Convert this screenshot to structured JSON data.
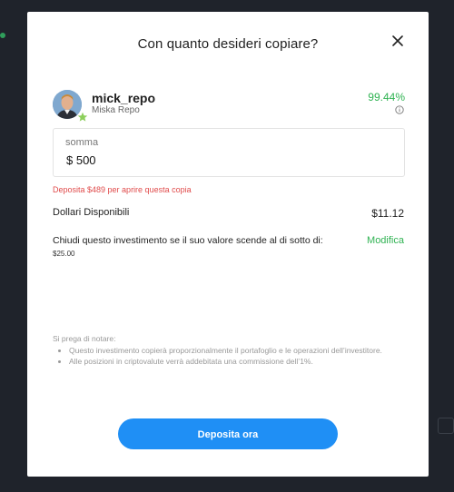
{
  "modal": {
    "title": "Con quanto desideri copiare?",
    "trader": {
      "username": "mick_repo",
      "display_name": "Miska Repo",
      "gain": "99.44%"
    },
    "amount": {
      "label": "somma",
      "value": "$ 500"
    },
    "warning": "Deposita $489 per aprire questa copia",
    "available": {
      "label": "Dollari Disponibili",
      "value": "$11.12"
    },
    "stoploss": {
      "label": "Chiudi questo investimento se il suo valore scende al di sotto di:",
      "value": "$25.00",
      "edit_label": "Modifica"
    },
    "notes": {
      "heading": "Si prega di notare:",
      "items": [
        "Questo investimento copierà proporzionalmente il portafoglio e le operazioni dell’investitore.",
        "Alle posizioni in criptovalute verrà addebitata una commissione dell’1%."
      ]
    },
    "cta_label": "Deposita ora"
  },
  "colors": {
    "accent_blue": "#1f8ff5",
    "positive_green": "#30b353",
    "warning_red": "#e04b4b"
  }
}
